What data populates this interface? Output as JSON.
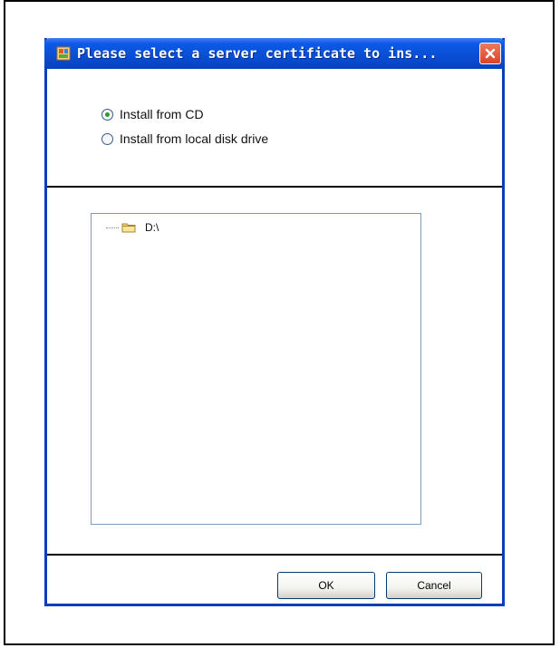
{
  "dialog": {
    "title": "Please select a server certificate to ins...",
    "colors": {
      "titlebar": "#0a4fd6",
      "close_button": "#d9432a",
      "border": "#0a3fb8"
    }
  },
  "source_options": [
    {
      "label": "Install from CD",
      "selected": true
    },
    {
      "label": "Install from local disk drive",
      "selected": false
    }
  ],
  "tree": {
    "items": [
      {
        "label": "D:\\",
        "icon": "folder-icon"
      }
    ]
  },
  "buttons": {
    "ok_label": "OK",
    "cancel_label": "Cancel"
  }
}
